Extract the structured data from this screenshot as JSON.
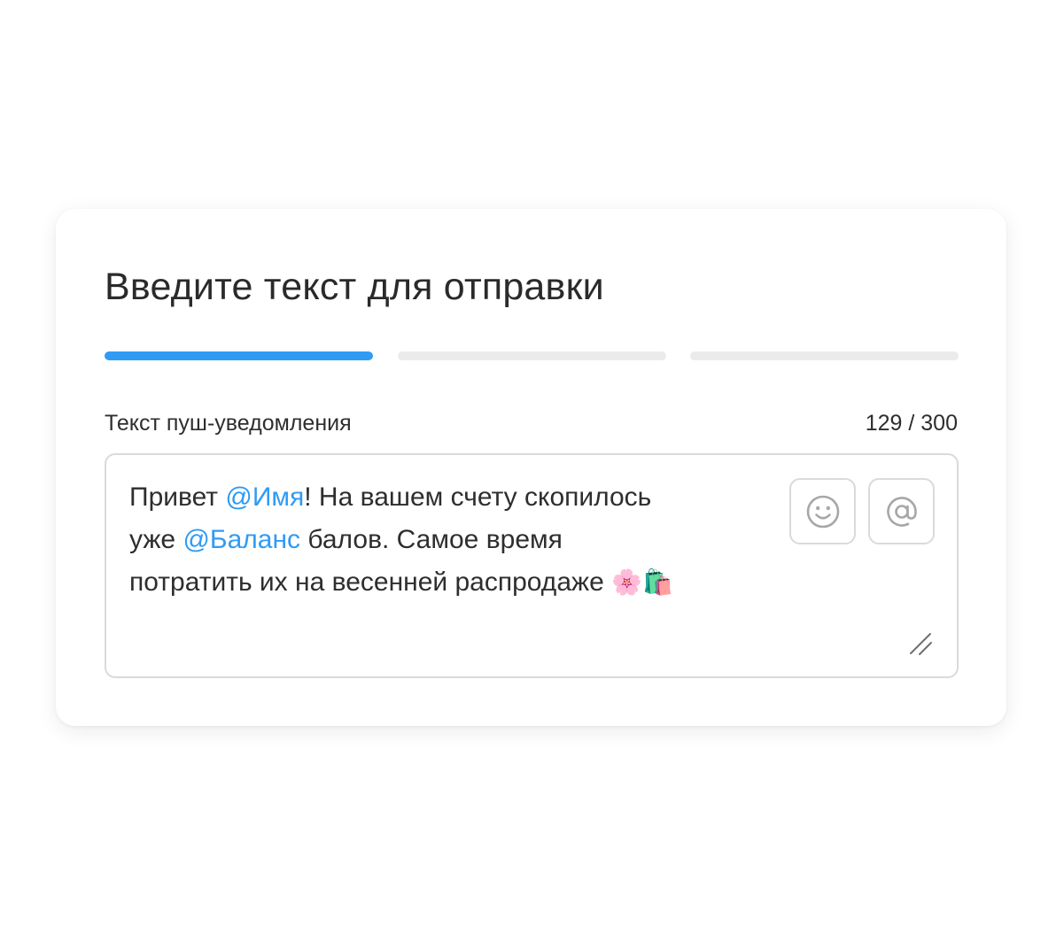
{
  "form": {
    "title": "Введите текст для отправки",
    "steps": {
      "total": 3,
      "active": 1
    },
    "field_label": "Текст пуш-уведомления",
    "counter": "129 / 300"
  },
  "message": {
    "t1": "Привет ",
    "v1": "@Имя",
    "t2": "! На вашем счету скопилось",
    "t3": "уже ",
    "v2": "@Баланс",
    "t4": " балов. Самое время",
    "t5": "потратить их на весенней распродаже ",
    "emoji": "🌸🛍️"
  },
  "toolbar": {
    "emoji_button_icon": "smiley-icon",
    "mention_button_icon": "at-sign-icon"
  },
  "colors": {
    "accent": "#2f9bf5",
    "inactive_step": "#ebebeb",
    "border": "#dadada",
    "text": "#2e2e2e"
  }
}
